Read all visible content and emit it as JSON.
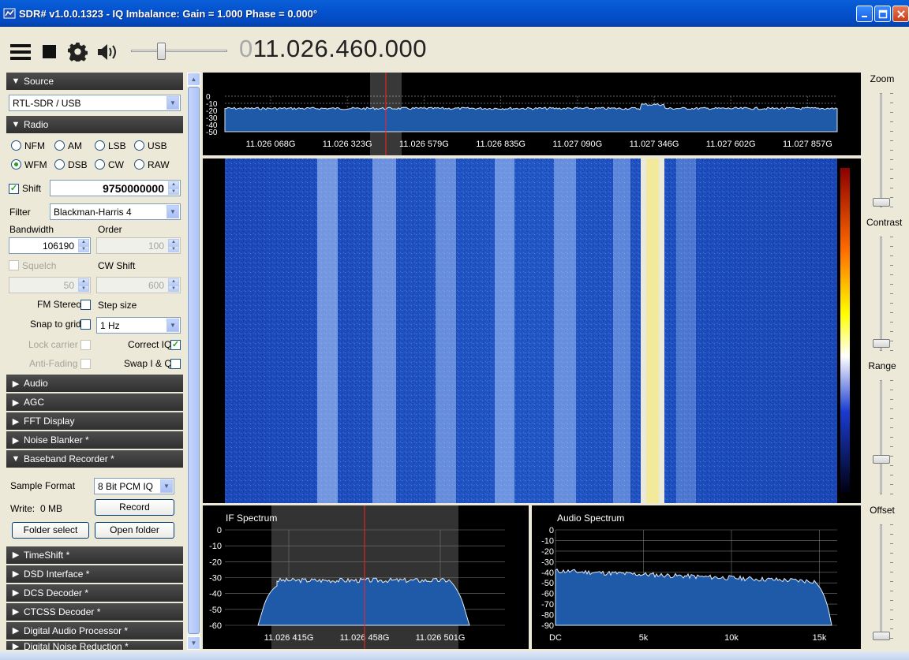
{
  "window": {
    "title": "SDR# v1.0.0.1323 - IQ Imbalance: Gain = 1.000 Phase = 0.000°",
    "icons": [
      "app-icon",
      "minimize-icon",
      "maximize-icon",
      "close-icon"
    ]
  },
  "toolbar": {
    "frequency_dim": "0",
    "frequency": "11.026.460.000",
    "volume_level": 0.3,
    "icons": [
      "menu-icon",
      "stop-icon",
      "gear-icon",
      "speaker-icon"
    ]
  },
  "source": {
    "header": "Source",
    "device": "RTL-SDR / USB"
  },
  "radio": {
    "header": "Radio",
    "modes": [
      "NFM",
      "AM",
      "LSB",
      "USB",
      "WFM",
      "DSB",
      "CW",
      "RAW"
    ],
    "selected_mode": "WFM",
    "shift_label": "Shift",
    "shift_value": "9750000000",
    "filter_label": "Filter",
    "filter_value": "Blackman-Harris 4",
    "bandwidth_label": "Bandwidth",
    "bandwidth_value": "106190",
    "order_label": "Order",
    "order_value": "100",
    "squelch_label": "Squelch",
    "squelch_value": "50",
    "cwshift_label": "CW Shift",
    "cwshift_value": "600",
    "fmstereo_label": "FM Stereo",
    "stepsize_label": "Step size",
    "snap_label": "Snap to grid",
    "snap_value": "1 Hz",
    "lockcarrier_label": "Lock carrier",
    "correctiq_label": "Correct IQ",
    "antifading_label": "Anti-Fading",
    "swapiq_label": "Swap I & Q"
  },
  "collapsed_sections": [
    "Audio",
    "AGC",
    "FFT Display",
    "Noise Blanker *"
  ],
  "baseband": {
    "header": "Baseband Recorder *",
    "format_label": "Sample Format",
    "format_value": "8 Bit PCM IQ",
    "write_label": "Write:",
    "write_value": "0 MB",
    "record_label": "Record",
    "folder_select_label": "Folder select",
    "open_folder_label": "Open folder"
  },
  "more_sections": [
    "TimeShift *",
    "DSD Interface *",
    "DCS Decoder *",
    "CTCSS Decoder *",
    "Digital Audio Processor *",
    "Digital Noise Reduction *"
  ],
  "right_controls": {
    "zoom_label": "Zoom",
    "contrast_label": "Contrast",
    "range_label": "Range",
    "offset_label": "Offset"
  },
  "spectrum": {
    "y_ticks": [
      "0",
      "-10",
      "-20",
      "-30",
      "-40",
      "-50"
    ],
    "x_ticks": [
      "11.026 068G",
      "11.026 323G",
      "11.026 579G",
      "11.026 835G",
      "11.027 090G",
      "11.027 346G",
      "11.027 602G",
      "11.027 857G"
    ]
  },
  "if_spectrum": {
    "title": "IF Spectrum",
    "y_ticks": [
      "0",
      "-10",
      "-20",
      "-30",
      "-40",
      "-50",
      "-60"
    ],
    "x_ticks": [
      "11.026 415G",
      "11.026 458G",
      "11.026 501G"
    ]
  },
  "audio_spectrum": {
    "title": "Audio Spectrum",
    "y_ticks": [
      "0",
      "-10",
      "-20",
      "-30",
      "-40",
      "-50",
      "-60",
      "-70",
      "-80",
      "-90"
    ],
    "x_ticks": [
      "DC",
      "5k",
      "10k",
      "15k"
    ]
  },
  "colors": {
    "title_bar": "#0453cf",
    "section_header": "#3a3a3a",
    "radio_selected": "#21a121",
    "spectrum_fill": "#1d5fae",
    "tuning_line": "#ff2020"
  }
}
